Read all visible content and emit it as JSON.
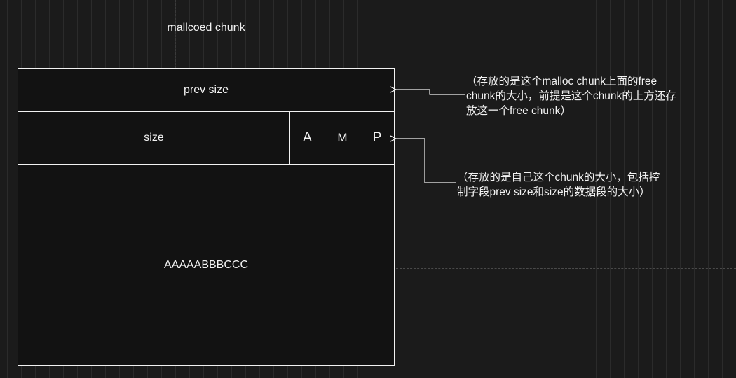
{
  "diagram": {
    "title": "mallcoed chunk",
    "prev_size_label": "prev size",
    "size_label": "size",
    "flags": [
      "A",
      "M",
      "P"
    ],
    "data_label": "AAAAABBBCCC",
    "annotations": {
      "prev_size": [
        "（存放的是这个malloc chunk上面的free",
        "chunk的大小，前提是这个chunk的上方还存",
        "放这一个free chunk）"
      ],
      "size": [
        "（存放的是自己这个chunk的大小，包括控",
        "制字段prev size和size的数据段的大小）"
      ]
    }
  },
  "colors": {
    "background": "#1b1b1b",
    "grid": "#2b2b2b",
    "box_fill": "#121212",
    "stroke": "#f2f2f2",
    "text": "#f0f0f0"
  }
}
